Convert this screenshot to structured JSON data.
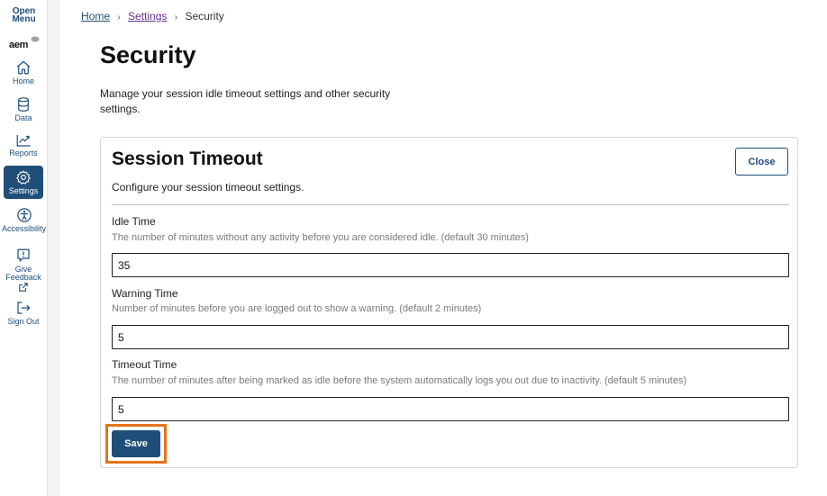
{
  "sidebar": {
    "open_menu_line1": "Open",
    "open_menu_line2": "Menu",
    "logo": "aem",
    "items": [
      {
        "label": "Home",
        "icon": "home-icon"
      },
      {
        "label": "Data",
        "icon": "database-icon"
      },
      {
        "label": "Reports",
        "icon": "chart-icon"
      },
      {
        "label": "Settings",
        "icon": "gear-icon",
        "active": true
      },
      {
        "label": "Accessibility",
        "icon": "accessibility-icon"
      },
      {
        "label_line1": "Give",
        "label_line2": "Feedback",
        "icon": "feedback-icon"
      },
      {
        "label": "Sign Out",
        "icon": "sign-out-icon"
      }
    ]
  },
  "breadcrumb": {
    "home": "Home",
    "settings": "Settings",
    "current": "Security",
    "separator": "›"
  },
  "page": {
    "title": "Security",
    "description": "Manage your session idle timeout settings and other security settings."
  },
  "card": {
    "title": "Session Timeout",
    "close_label": "Close",
    "description": "Configure your session timeout settings.",
    "fields": [
      {
        "label": "Idle Time",
        "help": "The number of minutes without any activity before you are considered idle. (default 30 minutes)",
        "value": "35"
      },
      {
        "label": "Warning Time",
        "help": "Number of minutes before you are logged out to show a warning. (default 2 minutes)",
        "value": "5"
      },
      {
        "label": "Timeout Time",
        "help": "The number of minutes after being marked as idle before the system automatically logs you out due to inactivity. (default 5 minutes)",
        "value": "5"
      }
    ],
    "save_label": "Save"
  },
  "colors": {
    "primary": "#1f4e79",
    "focus_ring": "#e8731a",
    "visited_link": "#6b2e8f"
  }
}
